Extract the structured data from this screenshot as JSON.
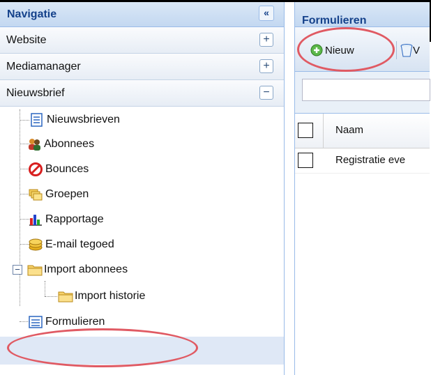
{
  "nav": {
    "title": "Navigatie",
    "collapse_glyph": "«",
    "sections": [
      {
        "label": "Website",
        "toggle": "+"
      },
      {
        "label": "Mediamanager",
        "toggle": "+"
      },
      {
        "label": "Nieuwsbrief",
        "toggle": "−"
      }
    ],
    "tree": [
      {
        "label": "Nieuwsbrieven",
        "icon": "newsletter-icon"
      },
      {
        "label": "Abonnees",
        "icon": "subscribers-icon"
      },
      {
        "label": "Bounces",
        "icon": "bounces-icon"
      },
      {
        "label": "Groepen",
        "icon": "groups-icon"
      },
      {
        "label": "Rapportage",
        "icon": "report-chart-icon"
      },
      {
        "label": "E-mail tegoed",
        "icon": "coins-icon"
      },
      {
        "label": "Import abonnees",
        "icon": "folder-icon"
      },
      {
        "label": "Import historie",
        "icon": "folder-icon"
      },
      {
        "label": "Formulieren",
        "icon": "form-icon"
      }
    ]
  },
  "main": {
    "title": "Formulieren",
    "toolbar": {
      "new_label": "Nieuw",
      "delete_label": "V"
    },
    "grid": {
      "column_naam": "Naam",
      "rows": [
        "Registratie eve"
      ]
    }
  },
  "colors": {
    "header_text": "#15428b",
    "annotation": "#e05a63",
    "selected_row": "#dfe8f6"
  }
}
